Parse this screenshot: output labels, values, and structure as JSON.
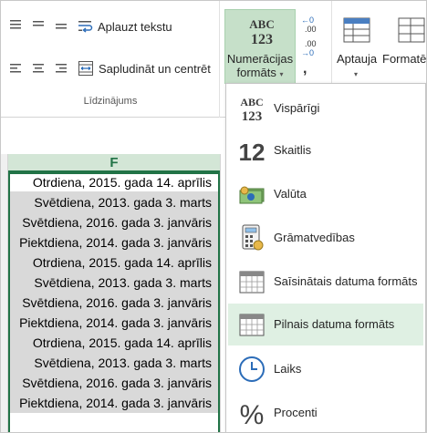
{
  "ribbon": {
    "wrap_text": "Aplauzt tekstu",
    "merge_center": "Sapludināt un centrēt",
    "alignment_group": "Līdzinājums",
    "number_format_line1": "Numerācijas",
    "number_format_line2": "formāts",
    "format_as_table": "Aptauja",
    "cell_format": "Formatēt",
    "comma_glyph": ","
  },
  "sheet": {
    "column": "F",
    "cells": [
      "Otrdiena, 2015. gada 14. aprīlis",
      "Svētdiena, 2013. gada 3. marts",
      "Svētdiena, 2016. gada 3. janvāris",
      "Piektdiena, 2014. gada 3. janvāris",
      "Otrdiena, 2015. gada 14. aprīlis",
      "Svētdiena, 2013. gada 3. marts",
      "Svētdiena, 2016. gada 3. janvāris",
      "Piektdiena, 2014. gada 3. janvāris",
      "Otrdiena, 2015. gada 14. aprīlis",
      "Svētdiena, 2013. gada 3. marts",
      "Svētdiena, 2016. gada 3. janvāris",
      "Piektdiena, 2014. gada 3. janvāris"
    ]
  },
  "menu": {
    "general": "Vispārīgi",
    "number": "Skaitlis",
    "currency": "Valūta",
    "accounting": "Grāmatvedības",
    "short_date": "Saīsinātais datuma formāts",
    "long_date": "Pilnais datuma formāts",
    "time": "Laiks",
    "percent": "Procenti"
  },
  "icons": {
    "abc_top": "ABC",
    "abc_bottom": "123",
    "number_glyph": "12",
    "percent_glyph": "%"
  },
  "colors": {
    "accent": "#217346",
    "selected_button": "#c6e0c9",
    "active_item": "#dff0e3"
  }
}
